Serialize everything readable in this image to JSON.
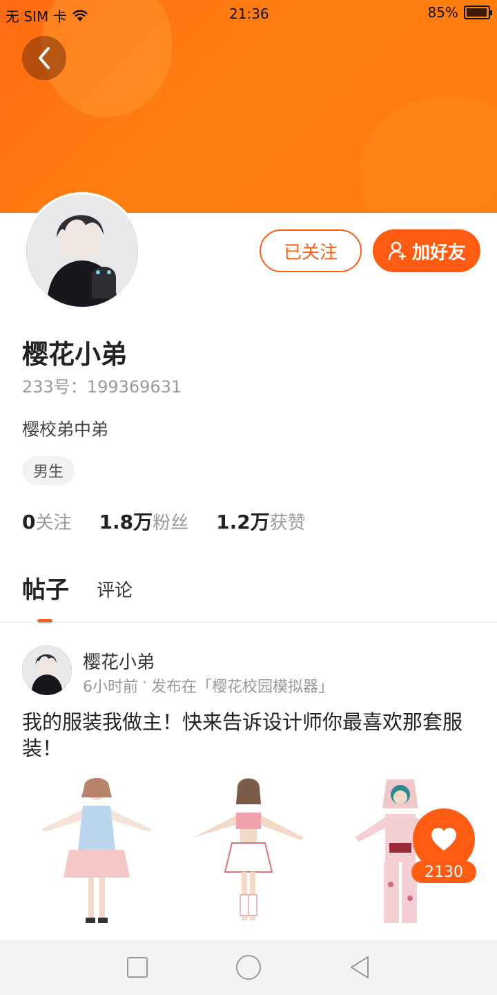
{
  "status_bar": {
    "carrier": "无 SIM 卡",
    "time": "21:36",
    "battery_text": "85%",
    "battery_level": 0.85,
    "icons": [
      "wifi-icon",
      "battery-icon"
    ]
  },
  "header": {
    "back_icon": "chevron-left-icon",
    "accent_color": "#ff5c13"
  },
  "profile": {
    "follow_button_label": "已关注",
    "add_friend_label": "加好友",
    "add_friend_icon": "user-plus-icon",
    "username": "樱花小弟",
    "account_id": "233号：199369631",
    "bio": "樱校弟中弟",
    "gender_tag": "男生",
    "stats": [
      {
        "value": "0",
        "label": "关注"
      },
      {
        "value": "1.8万",
        "label": "粉丝"
      },
      {
        "value": "1.2万",
        "label": "获赞"
      }
    ]
  },
  "tabs": [
    {
      "label": "帖子",
      "active": true
    },
    {
      "label": "评论",
      "active": false
    }
  ],
  "post": {
    "author": "樱花小弟",
    "time": "6小时前",
    "separator": "·",
    "published_in": "发布在「樱花校园模拟器」",
    "text": "我的服装我做主！快来告诉设计师你最喜欢那套服装！",
    "like_count": "2130",
    "like_icon": "heart-icon"
  },
  "nav_bar": {
    "icons": [
      "recent-apps-icon",
      "home-icon",
      "back-triangle-icon"
    ]
  }
}
